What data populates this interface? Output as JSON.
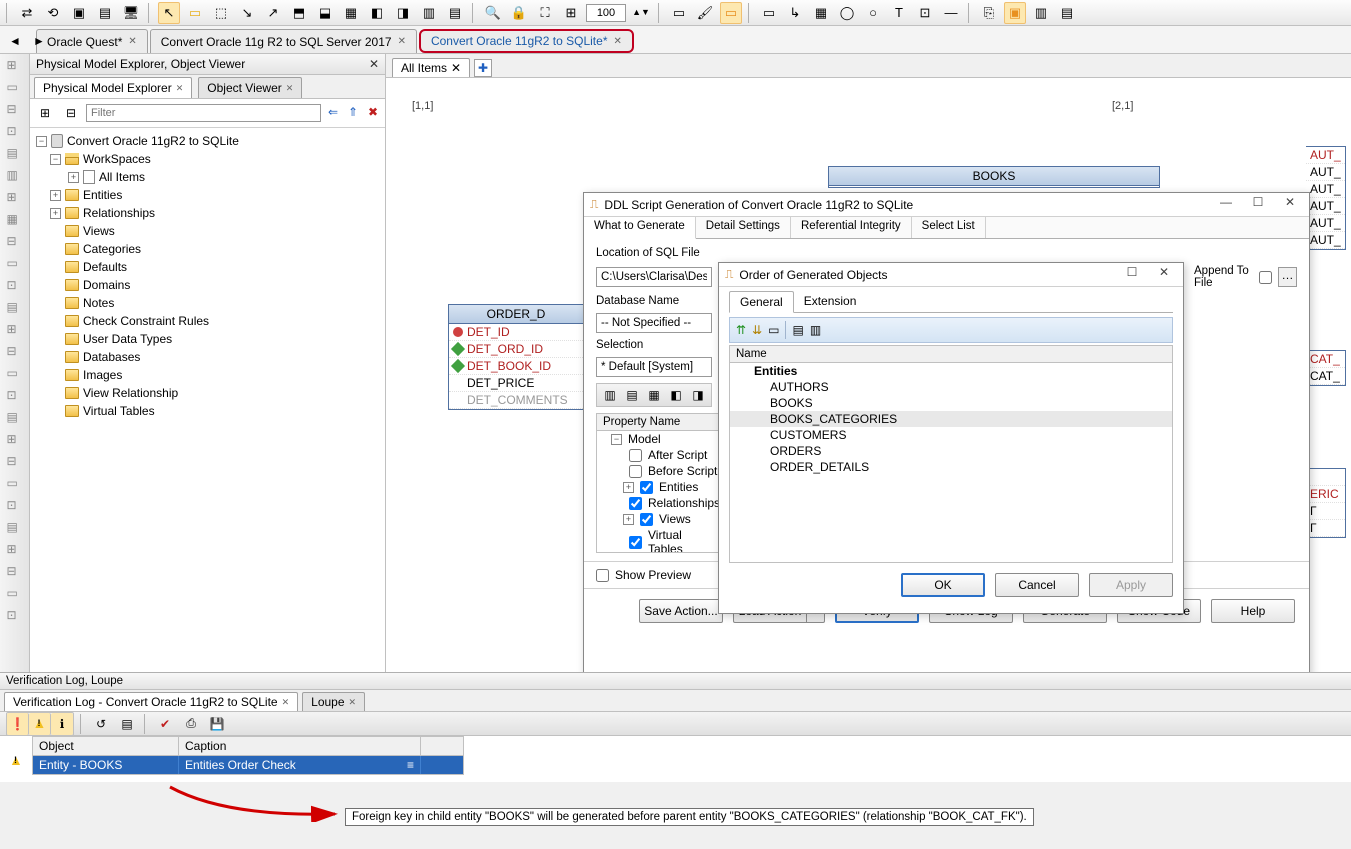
{
  "toolbar": {
    "zoom": "100"
  },
  "doc_tabs": [
    {
      "label": "Oracle Quest*"
    },
    {
      "label": "Convert Oracle 11g R2 to SQL Server 2017"
    },
    {
      "label": "Convert Oracle 11gR2 to SQLite*",
      "highlighted": true
    }
  ],
  "explorer": {
    "title": "Physical Model Explorer, Object Viewer",
    "tabs": [
      {
        "label": "Physical Model Explorer"
      },
      {
        "label": "Object Viewer"
      }
    ],
    "filter_placeholder": "Filter",
    "tree": {
      "root": "Convert Oracle 11gR2 to SQLite",
      "workspaces": "WorkSpaces",
      "all_items": "All Items",
      "nodes": [
        "Entities",
        "Relationships",
        "Views",
        "Categories",
        "Defaults",
        "Domains",
        "Notes",
        "Check Constraint Rules",
        "User Data Types",
        "Databases",
        "Images",
        "View Relationship",
        "Virtual Tables"
      ]
    }
  },
  "diagram": {
    "tab": "All Items",
    "cells": {
      "a": "[1,1]",
      "b": "[2,1]"
    },
    "order_details": {
      "title": "ORDER_D",
      "rows": [
        {
          "name": "DET_ID",
          "pk": true
        },
        {
          "name": "DET_ORD_ID",
          "fk": true
        },
        {
          "name": "DET_BOOK_ID",
          "fk": true
        },
        {
          "name": "DET_PRICE"
        },
        {
          "name": "DET_COMMENTS",
          "gray": true
        }
      ]
    },
    "books": {
      "title": "BOOKS"
    },
    "aut_cols": [
      "AUT_",
      "AUT_",
      "AUT_",
      "AUT_",
      "AUT_",
      "AUT_"
    ],
    "cat_cols": [
      "CAT_",
      "CAT_"
    ],
    "eric": "ERIC"
  },
  "ddl": {
    "title": "DDL Script Generation of Convert Oracle 11gR2 to SQLite",
    "tabs": [
      "What to Generate",
      "Detail Settings",
      "Referential Integrity",
      "Select List"
    ],
    "loc_label": "Location of SQL File",
    "loc_value": "C:\\Users\\Clarisa\\Desktop",
    "db_label": "Database Name",
    "db_value": "-- Not Specified --",
    "sel_label": "Selection",
    "sel_value": "* Default [System]",
    "append_label": "Append To File",
    "prop_header": "Property Name",
    "props": {
      "model": "Model",
      "after": "After Script",
      "before": "Before Script",
      "entities": "Entities",
      "rels": "Relationships",
      "views": "Views",
      "vtables": "Virtual Tables"
    },
    "show_preview": "Show Preview",
    "buttons": {
      "save": "Save Action...",
      "load": "Load Action",
      "verify": "Verify",
      "showlog": "Show Log",
      "generate": "Generate",
      "showcode": "Show Code",
      "help": "Help"
    }
  },
  "order": {
    "title": "Order of Generated Objects",
    "tabs": [
      "General",
      "Extension"
    ],
    "name_header": "Name",
    "section": "Entities",
    "items": [
      "AUTHORS",
      "BOOKS",
      "BOOKS_CATEGORIES",
      "CUSTOMERS",
      "ORDERS",
      "ORDER_DETAILS"
    ],
    "selected": "BOOKS_CATEGORIES",
    "ok": "OK",
    "cancel": "Cancel",
    "apply": "Apply"
  },
  "verification": {
    "title": "Verification Log, Loupe",
    "tabs": [
      {
        "label": "Verification Log - Convert Oracle 11gR2 to SQLite"
      },
      {
        "label": "Loupe"
      }
    ],
    "columns": {
      "object": "Object",
      "caption": "Caption"
    },
    "row": {
      "object": "Entity - BOOKS",
      "caption": "Entities Order Check"
    },
    "tooltip": "Foreign key in child entity \"BOOKS\" will be generated before parent entity \"BOOKS_CATEGORIES\" (relationship \"BOOK_CAT_FK\")."
  }
}
